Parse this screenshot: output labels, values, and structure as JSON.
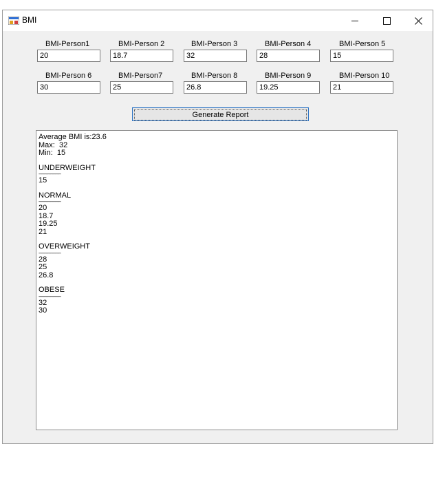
{
  "window": {
    "title": "BMI"
  },
  "labels": [
    "BMI-Person1",
    "BMI-Person 2",
    "BMI-Person 3",
    "BMI-Person 4",
    "BMI-Person 5",
    "BMI-Person 6",
    "BMI-Person7",
    "BMI-Person 8",
    "BMI-Person 9",
    "BMI-Person 10"
  ],
  "values": [
    "20",
    "18.7",
    "32",
    "28",
    "15",
    "30",
    "25",
    "26.8",
    "19.25",
    "21"
  ],
  "button": {
    "label": "Generate Report"
  },
  "report": {
    "average": "Average BMI is:23.6",
    "max": "Max:  32",
    "min": "Min:  15",
    "separator": "------------------------",
    "underweight": {
      "heading": "UNDERWEIGHT",
      "values": [
        "15"
      ]
    },
    "normal": {
      "heading": "NORMAL",
      "values": [
        "20",
        "18.7",
        "19.25",
        "21"
      ]
    },
    "overweight": {
      "heading": "OVERWEIGHT",
      "values": [
        "28",
        "25",
        "26.8"
      ]
    },
    "obese": {
      "heading": "OBESE",
      "values": [
        "32",
        "30"
      ]
    }
  }
}
